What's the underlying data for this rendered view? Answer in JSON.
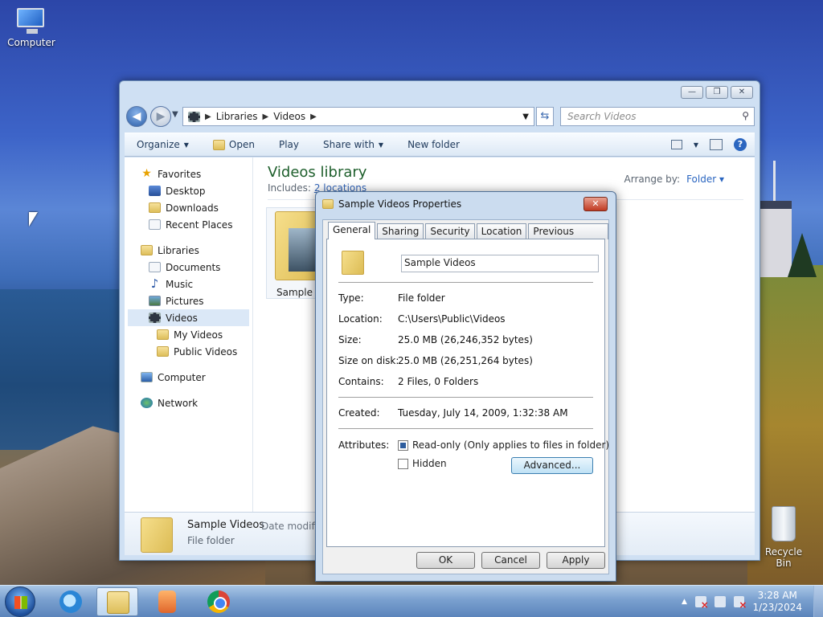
{
  "desktop": {
    "icons": [
      {
        "label": "Computer"
      },
      {
        "label": "Recycle Bin"
      }
    ]
  },
  "explorer": {
    "breadcrumb": [
      "Libraries",
      "Videos"
    ],
    "search_placeholder": "Search Videos",
    "toolbar": {
      "organize": "Organize",
      "open": "Open",
      "play": "Play",
      "share_with": "Share with",
      "new_folder": "New folder"
    },
    "nav": {
      "favorites": "Favorites",
      "desktop": "Desktop",
      "downloads": "Downloads",
      "recent_places": "Recent Places",
      "libraries": "Libraries",
      "documents": "Documents",
      "music": "Music",
      "pictures": "Pictures",
      "videos": "Videos",
      "my_videos": "My Videos",
      "public_videos": "Public Videos",
      "computer": "Computer",
      "network": "Network"
    },
    "library_title": "Videos library",
    "includes_label": "Includes:",
    "includes_link": "2 locations",
    "arrange_label": "Arrange by:",
    "arrange_value": "Folder",
    "tile_label": "Sample V",
    "details": {
      "name": "Sample Videos",
      "date_label": "Date modifie",
      "type": "File folder"
    }
  },
  "dialog": {
    "title": "Sample Videos Properties",
    "tabs": [
      "General",
      "Sharing",
      "Security",
      "Location",
      "Previous Versions"
    ],
    "active_tab": "General",
    "name_value": "Sample Videos",
    "fields": {
      "type_label": "Type:",
      "type_value": "File folder",
      "location_label": "Location:",
      "location_value": "C:\\Users\\Public\\Videos",
      "size_label": "Size:",
      "size_value": "25.0 MB (26,246,352 bytes)",
      "size_on_disk_label": "Size on disk:",
      "size_on_disk_value": "25.0 MB (26,251,264 bytes)",
      "contains_label": "Contains:",
      "contains_value": "2 Files, 0 Folders",
      "created_label": "Created:",
      "created_value": "Tuesday, July 14, 2009, 1:32:38 AM",
      "attributes_label": "Attributes:"
    },
    "readonly_label": "Read-only (Only applies to files in folder)",
    "readonly_checked": true,
    "hidden_label": "Hidden",
    "hidden_checked": false,
    "advanced_button": "Advanced...",
    "ok_button": "OK",
    "cancel_button": "Cancel",
    "apply_button": "Apply"
  },
  "taskbar": {
    "time": "3:28 AM",
    "date": "1/23/2024"
  }
}
